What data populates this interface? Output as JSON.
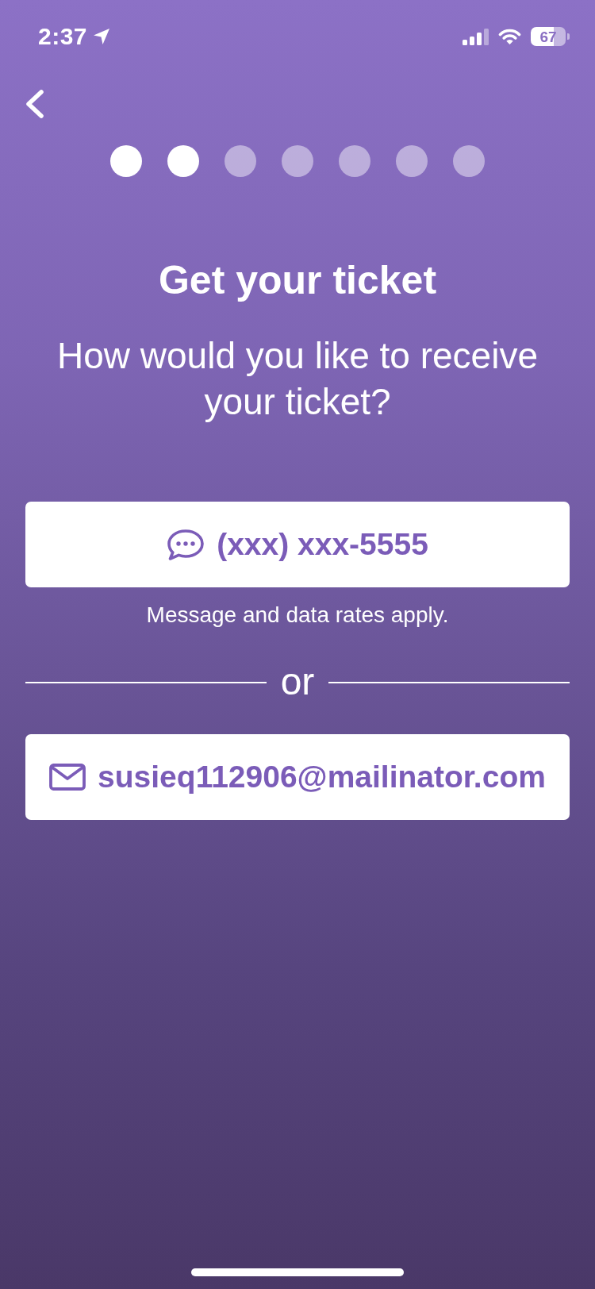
{
  "status_bar": {
    "time": "2:37",
    "battery": "67"
  },
  "steps": [
    {
      "filled": true
    },
    {
      "filled": true
    },
    {
      "filled": false
    },
    {
      "filled": false
    },
    {
      "filled": false
    },
    {
      "filled": false
    },
    {
      "filled": false
    }
  ],
  "title": "Get your ticket",
  "subtitle": "How would you like to receive your ticket?",
  "sms_option": {
    "label": "(xxx) xxx-5555",
    "note": "Message and data rates apply."
  },
  "divider": "or",
  "email_option": {
    "label": "susieq112906@mailinator.com"
  }
}
